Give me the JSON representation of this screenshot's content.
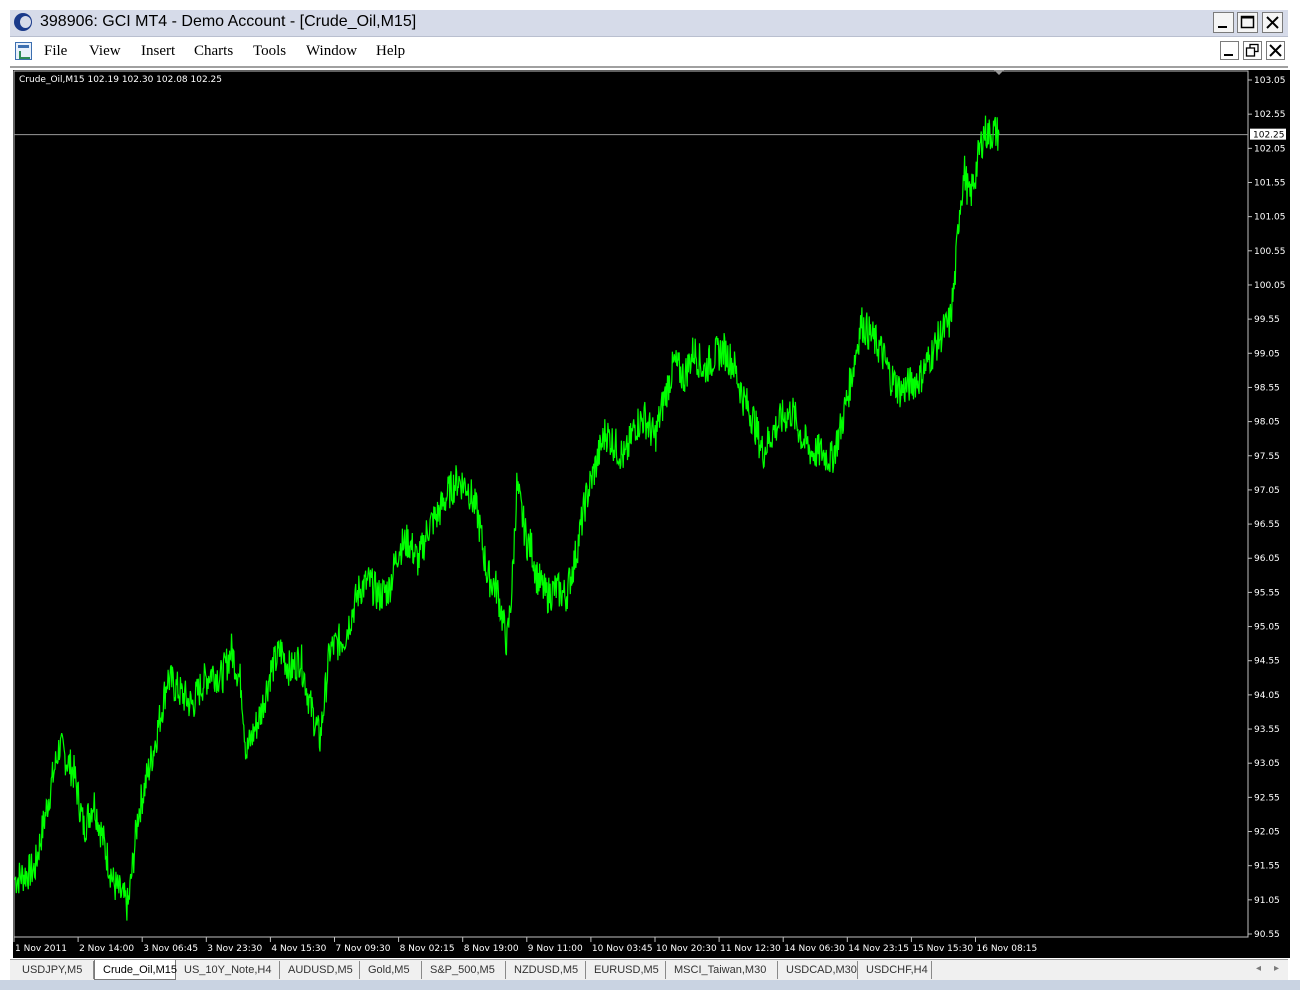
{
  "window": {
    "title": "398906: GCI MT4 - Demo Account - [Crude_Oil,M15]",
    "buttons": [
      "minimize",
      "maximize",
      "close"
    ]
  },
  "menubar": {
    "items": [
      "File",
      "View",
      "Insert",
      "Charts",
      "Tools",
      "Window",
      "Help"
    ]
  },
  "chart": {
    "info_label": "Crude_Oil,M15  102.19 102.30 102.08 102.25",
    "current_price_label": "102.25",
    "line_color": "#00ff00",
    "background": "#000000"
  },
  "tabs": {
    "items": [
      "USDJPY,M5",
      "Crude_Oil,M15",
      "US_10Y_Note,H4",
      "AUDUSD,M5",
      "Gold,M5",
      "S&P_500,M5",
      "NZDUSD,M5",
      "EURUSD,M5",
      "MSCI_Taiwan,M30",
      "USDCAD,M30",
      "USDCHF,H4"
    ],
    "active": "Crude_Oil,M15"
  },
  "chart_data": {
    "type": "line",
    "symbol": "Crude_Oil",
    "timeframe": "M15",
    "ohlc_last": {
      "open": 102.19,
      "high": 102.3,
      "low": 102.08,
      "close": 102.25
    },
    "current_price": 102.25,
    "ylim": [
      90.55,
      103.05
    ],
    "y_ticks": [
      "103.05",
      "102.55",
      "102.05",
      "101.55",
      "101.05",
      "100.55",
      "100.05",
      "99.55",
      "99.05",
      "98.55",
      "98.05",
      "97.55",
      "97.05",
      "96.55",
      "96.05",
      "95.55",
      "95.05",
      "94.55",
      "94.05",
      "93.55",
      "93.05",
      "92.55",
      "92.05",
      "91.55",
      "91.05",
      "90.55"
    ],
    "x_ticks": [
      "1 Nov 2011",
      "2 Nov 14:00",
      "3 Nov 06:45",
      "3 Nov 23:30",
      "4 Nov 15:30",
      "7 Nov 09:30",
      "8 Nov 02:15",
      "8 Nov 19:00",
      "9 Nov 11:00",
      "10 Nov 03:45",
      "10 Nov 20:30",
      "11 Nov 12:30",
      "14 Nov 06:30",
      "14 Nov 23:15",
      "15 Nov 15:30",
      "16 Nov 08:15"
    ],
    "series": [
      {
        "x": [
          0,
          0.02,
          0.035,
          0.045,
          0.06,
          0.07,
          0.08,
          0.095,
          0.1,
          0.115,
          0.12,
          0.125,
          0.14,
          0.15,
          0.155,
          0.17,
          0.18,
          0.19,
          0.2,
          0.21,
          0.22,
          0.23,
          0.235,
          0.25,
          0.26,
          0.27,
          0.28,
          0.29,
          0.3,
          0.31,
          0.32,
          0.335,
          0.35,
          0.36,
          0.37,
          0.38,
          0.39,
          0.4,
          0.41,
          0.42,
          0.43,
          0.44,
          0.45,
          0.46,
          0.47,
          0.48,
          0.49,
          0.5,
          0.505,
          0.51,
          0.52,
          0.525,
          0.53,
          0.54,
          0.55,
          0.56,
          0.57,
          0.58,
          0.59,
          0.6,
          0.61,
          0.62,
          0.63,
          0.64,
          0.65,
          0.66,
          0.67,
          0.68,
          0.69,
          0.7,
          0.71,
          0.72,
          0.73,
          0.74,
          0.75,
          0.76,
          0.77,
          0.78,
          0.79,
          0.8,
          0.81,
          0.82,
          0.83,
          0.84,
          0.85,
          0.86,
          0.87,
          0.88,
          0.89,
          0.9,
          0.91,
          0.92,
          0.93,
          0.94,
          0.95,
          0.955,
          0.96,
          0.965,
          0.97,
          0.975,
          0.98,
          0.985,
          0.99,
          0.995,
          1.0
        ],
        "y": [
          91.35,
          91.5,
          92.6,
          93.3,
          92.9,
          92.1,
          92.5,
          91.6,
          91.3,
          90.95,
          91.6,
          92.3,
          93.2,
          93.9,
          94.3,
          94.05,
          93.9,
          94.2,
          94.4,
          94.3,
          94.7,
          94.2,
          93.2,
          93.8,
          94.4,
          94.7,
          94.4,
          94.6,
          93.9,
          93.4,
          94.7,
          94.9,
          95.6,
          95.7,
          95.5,
          95.6,
          96.2,
          96.3,
          96.0,
          96.5,
          96.7,
          97.0,
          97.2,
          97.1,
          96.7,
          95.8,
          95.6,
          94.8,
          95.6,
          97.1,
          96.3,
          96.2,
          95.8,
          95.5,
          95.6,
          95.5,
          96.1,
          96.9,
          97.4,
          97.9,
          97.7,
          97.5,
          98.0,
          98.1,
          97.8,
          98.4,
          98.9,
          98.7,
          99.1,
          98.8,
          99.0,
          99.1,
          98.9,
          98.4,
          98.1,
          97.6,
          97.9,
          98.1,
          98.2,
          97.8,
          97.6,
          97.6,
          97.5,
          98.0,
          98.7,
          99.5,
          99.3,
          99.1,
          98.7,
          98.5,
          98.6,
          98.7,
          99.0,
          99.3,
          99.5,
          100.1,
          101.2,
          101.7,
          101.3,
          101.6,
          102.0,
          102.3,
          102.25,
          102.3,
          102.25
        ]
      }
    ]
  }
}
